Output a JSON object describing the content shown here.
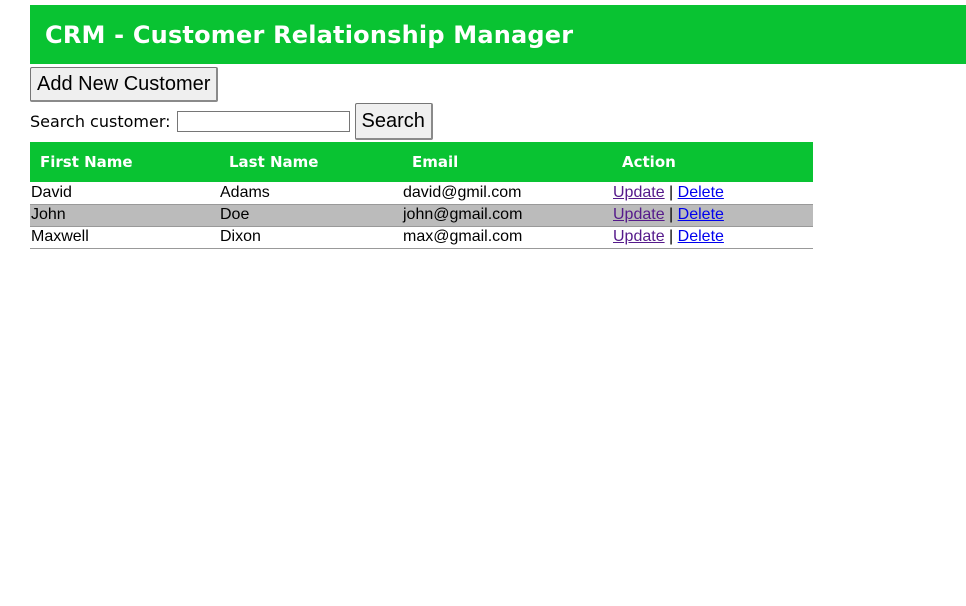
{
  "header": {
    "title": "CRM - Customer Relationship Manager"
  },
  "toolbar": {
    "add_label": "Add New Customer",
    "search_label": "Search customer:",
    "search_value": "",
    "search_button": "Search"
  },
  "table": {
    "columns": [
      "First Name",
      "Last Name",
      "Email",
      "Action"
    ],
    "rows": [
      {
        "first": "David",
        "last": "Adams",
        "email": "david@gmil.com",
        "update": "Update",
        "sep": "|",
        "delete": "Delete"
      },
      {
        "first": "John",
        "last": "Doe",
        "email": "john@gmail.com",
        "update": "Update",
        "sep": "|",
        "delete": "Delete"
      },
      {
        "first": "Maxwell",
        "last": "Dixon",
        "email": "max@gmail.com",
        "update": "Update",
        "sep": "|",
        "delete": "Delete"
      }
    ]
  },
  "colors": {
    "accent": "#09c332",
    "alt_row": "#bbbbbb",
    "visited_link": "#551a8b",
    "link": "#0000ee"
  }
}
